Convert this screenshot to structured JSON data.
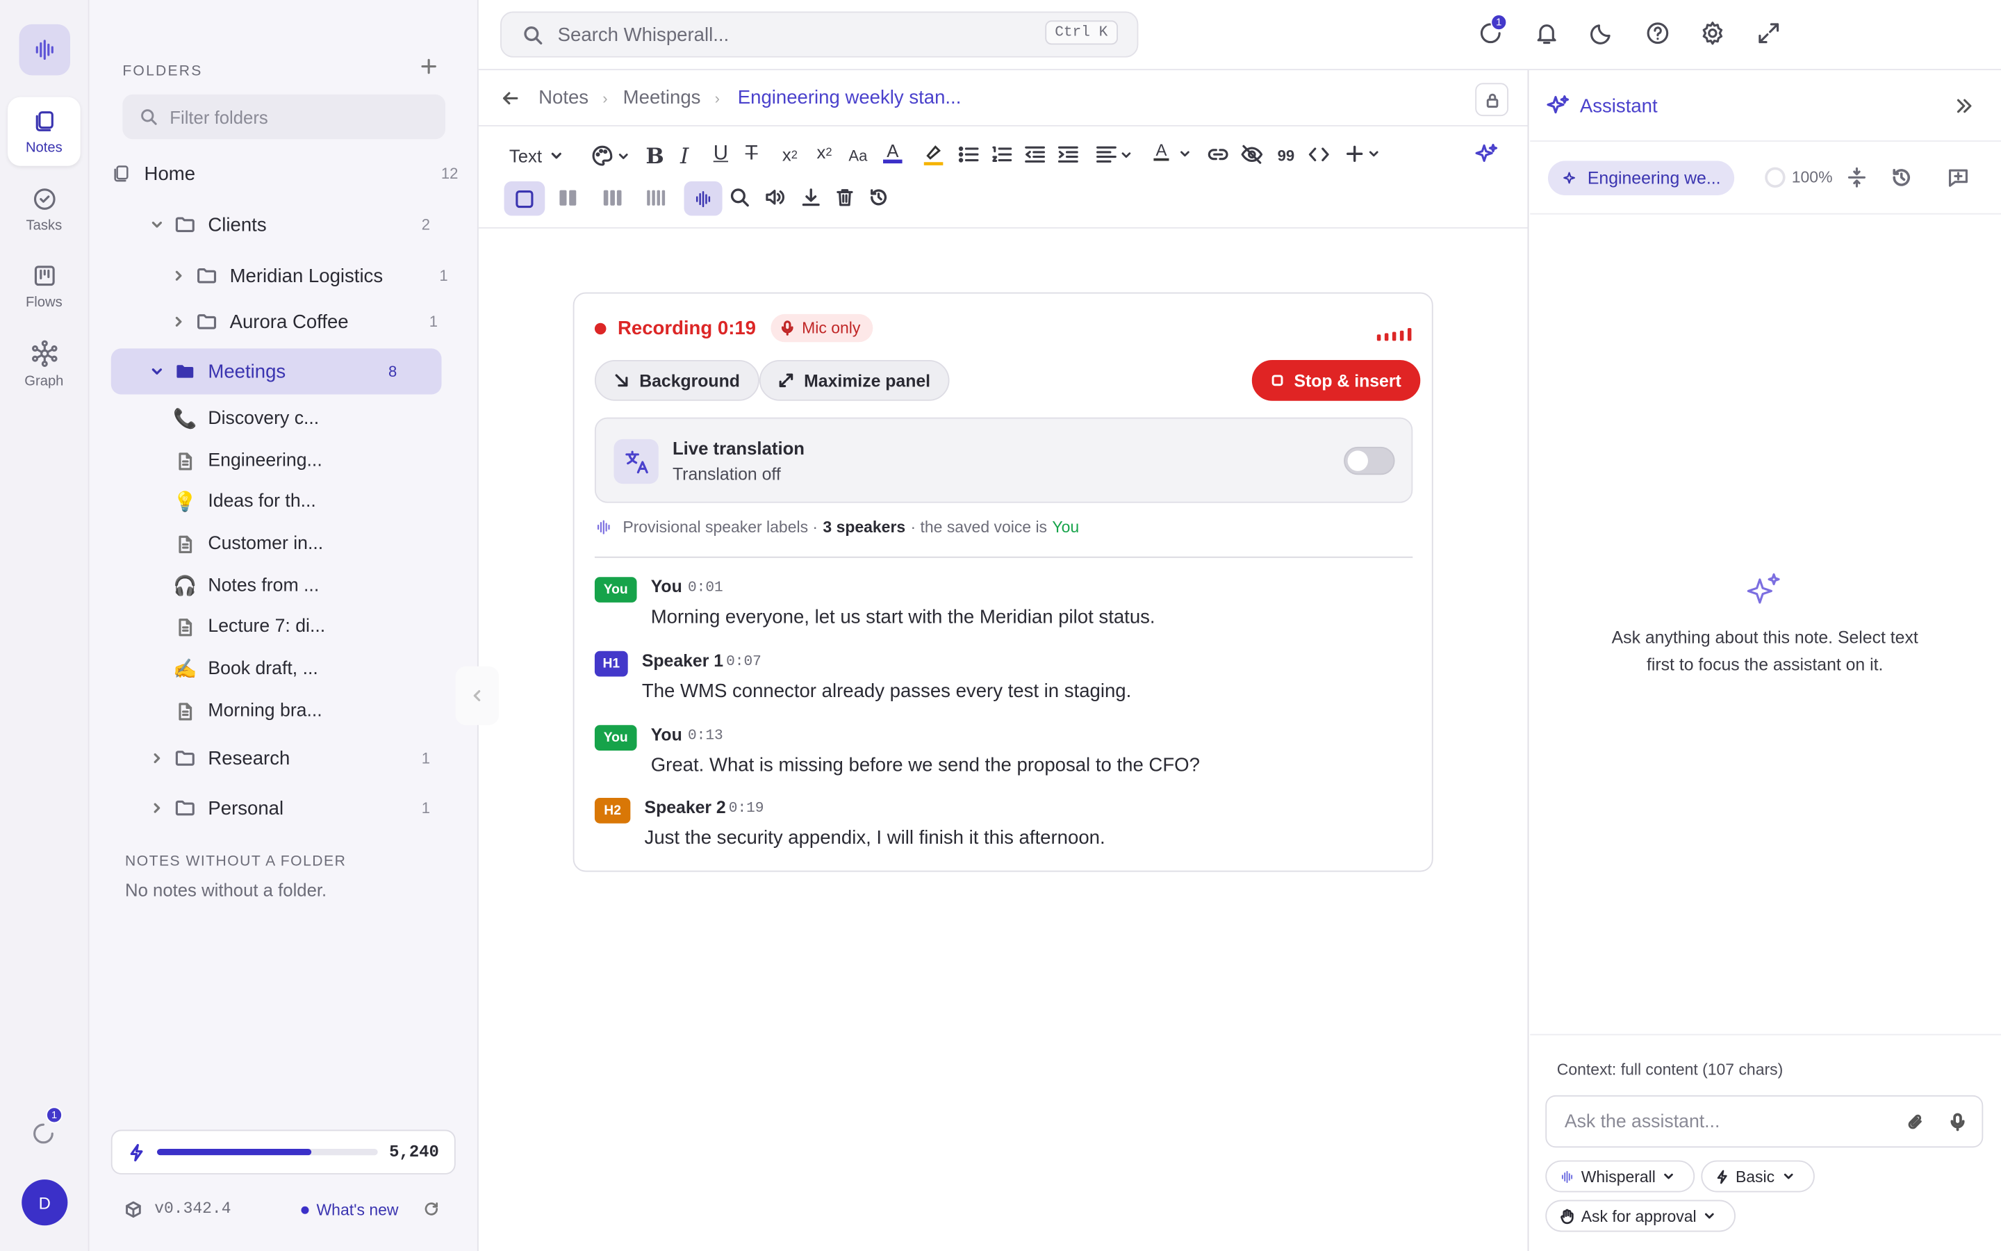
{
  "rail": {
    "items": [
      {
        "label": "Notes"
      },
      {
        "label": "Tasks"
      },
      {
        "label": "Flows"
      },
      {
        "label": "Graph"
      }
    ],
    "sync_badge": "1",
    "avatar": "D"
  },
  "sidebar": {
    "title": "FOLDERS",
    "filter_placeholder": "Filter folders",
    "home": {
      "label": "Home",
      "count": "12"
    },
    "clients": {
      "label": "Clients",
      "count": "2"
    },
    "meridian": {
      "label": "Meridian Logistics",
      "count": "1"
    },
    "aurora": {
      "label": "Aurora Coffee",
      "count": "1"
    },
    "meetings": {
      "label": "Meetings",
      "count": "8"
    },
    "notes": [
      {
        "icon": "📞",
        "label": "Discovery c..."
      },
      {
        "icon": "doc",
        "label": "Engineering..."
      },
      {
        "icon": "💡",
        "label": "Ideas for th..."
      },
      {
        "icon": "doc",
        "label": "Customer in..."
      },
      {
        "icon": "🎧",
        "label": "Notes from ..."
      },
      {
        "icon": "doc",
        "label": "Lecture 7: di..."
      },
      {
        "icon": "✍️",
        "label": "Book draft, ..."
      },
      {
        "icon": "doc",
        "label": "Morning bra..."
      }
    ],
    "research": {
      "label": "Research",
      "count": "1"
    },
    "personal": {
      "label": "Personal",
      "count": "1"
    },
    "no_folder_title": "NOTES WITHOUT A FOLDER",
    "no_folder_text": "No notes without a folder.",
    "credits": "5,240",
    "credits_fill": 0.7,
    "version": "v0.342.4",
    "whats_new": "What's new"
  },
  "topbar": {
    "search_placeholder": "Search Whisperall...",
    "shortcut": "Ctrl K",
    "activity_badge": "1"
  },
  "breadcrumb": {
    "items": [
      "Notes",
      "Meetings",
      "Engineering weekly stan..."
    ]
  },
  "toolbar": {
    "block_type": "Text"
  },
  "recording": {
    "title": "Recording 0:19",
    "mode": "Mic only",
    "background_label": "Background",
    "maximize_label": "Maximize panel",
    "stop_label": "Stop & insert",
    "live_title": "Live translation",
    "live_status": "Translation off",
    "prov_prefix": "Provisional speaker labels ·",
    "prov_count": "3 speakers",
    "prov_mid": "· the saved voice is",
    "prov_you": "You",
    "segments": [
      {
        "tag": "You",
        "speaker": "You",
        "time": "0:01",
        "text": "Morning everyone, let us start with the Meridian pilot status."
      },
      {
        "tag": "H1",
        "speaker": "Speaker 1",
        "time": "0:07",
        "text": "The WMS connector already passes every test in staging."
      },
      {
        "tag": "You",
        "speaker": "You",
        "time": "0:13",
        "text": "Great. What is missing before we send the proposal to the CFO?"
      },
      {
        "tag": "H2",
        "speaker": "Speaker 2",
        "time": "0:19",
        "text": "Just the security appendix, I will finish it this afternoon."
      }
    ]
  },
  "assistant": {
    "title": "Assistant",
    "context_chip": "Engineering we...",
    "percent": "100%",
    "empty_text": "Ask anything about this note. Select text first to focus the assistant on it.",
    "context_info": "Context: full content (107 chars)",
    "input_placeholder": "Ask the assistant...",
    "model": "Whisperall",
    "mode": "Basic",
    "approval": "Ask for approval"
  },
  "colors": {
    "accent": "#3b30c8",
    "record_red": "#dc2626",
    "you_green": "#16a34a",
    "h1_indigo": "#4338ca",
    "h2_orange": "#d97706"
  }
}
